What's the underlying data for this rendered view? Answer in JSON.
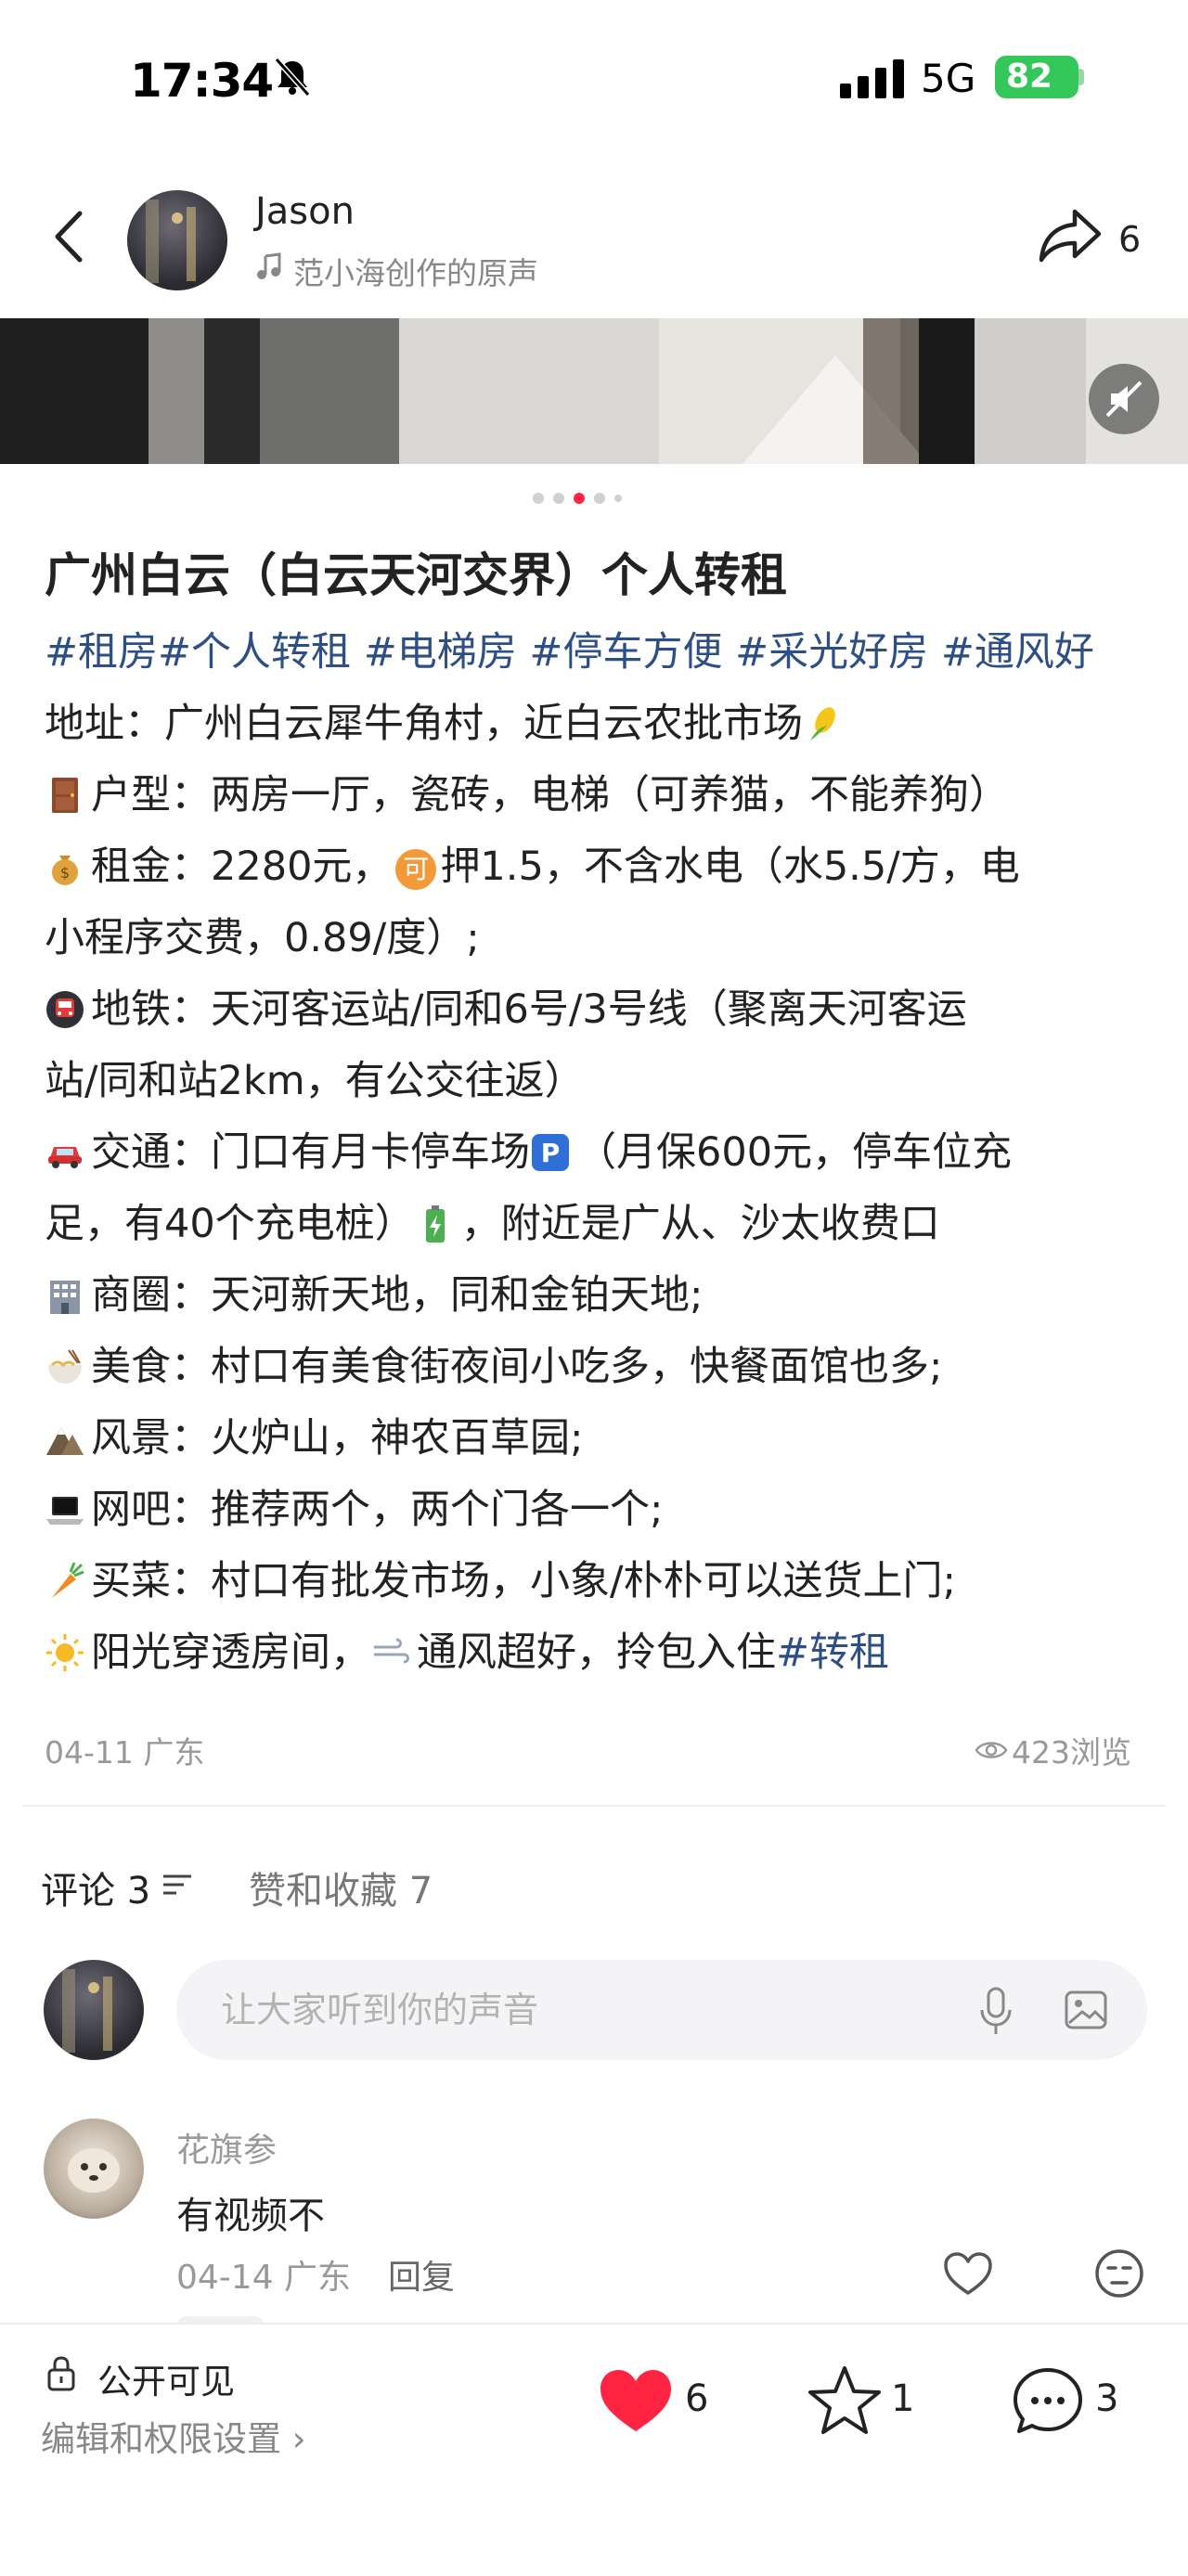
{
  "status_bar": {
    "time": "17:34",
    "network": "5G",
    "battery": "82"
  },
  "header": {
    "author_name": "Jason",
    "music_source": "范小海创作的原声",
    "share_count": "6"
  },
  "post": {
    "title": "广州白云（白云天河交界）个人转租",
    "hashtags": "#租房#个人转租 #电梯房 #停车方便 #采光好房 #通风好",
    "lines": [
      "地址：广州白云犀牛角村，近白云农批市场",
      "户型：两房一厅，瓷砖，电梯（可养猫，不能养狗）",
      "租金：2280元，",
      "押1.5，不含水电（水5.5/方，电",
      "小程序交费，0.89/度）;",
      "地铁：天河客运站/同和6号/3号线（聚离天河客运",
      "站/同和站2km，有公交往返）",
      "交通：门口有月卡停车场",
      "（月保600元，停车位充",
      "足，有40个充电桩）",
      "，附近是广从、沙太收费口",
      "商圈：天河新天地，同和金铂天地;",
      "美食：村口有美食街夜间小吃多，快餐面馆也多;",
      "风景：火炉山，神农百草园;",
      "网吧：推荐两个，两个门各一个;",
      "买菜：村口有批发市场，小象/朴朴可以送货上门;",
      "阳光穿透房间，",
      "通风超好，拎包入住",
      "#转租"
    ],
    "badge_char": "可",
    "date_location": "04-11 广东",
    "view_count": "423浏览"
  },
  "comments_section": {
    "comments_tab": "评论 3",
    "likes_tab": "赞和收藏 7",
    "input_placeholder": "让大家听到你的声音"
  },
  "comment": {
    "author": "花旗参",
    "text": "有视频不",
    "meta": "04-14 广东",
    "reply_label": "回复"
  },
  "bottom_bar": {
    "visibility": "公开可见",
    "settings_link": "编辑和权限设置 ›",
    "like_count": "6",
    "fav_count": "1",
    "comment_count": "3"
  },
  "colors": {
    "accent_tag": "#2e4f85",
    "heart": "#ff2442",
    "battery": "#34c759"
  },
  "icons": [
    "bell-slash-icon",
    "signal-icon",
    "back-chevron-icon",
    "music-note-icon",
    "share-icon",
    "mute-icon",
    "eye-icon",
    "sort-icon",
    "mic-icon",
    "image-icon",
    "heart-outline-icon",
    "emoji-icon",
    "lock-icon",
    "heart-icon",
    "star-icon",
    "comment-bubble-icon"
  ]
}
